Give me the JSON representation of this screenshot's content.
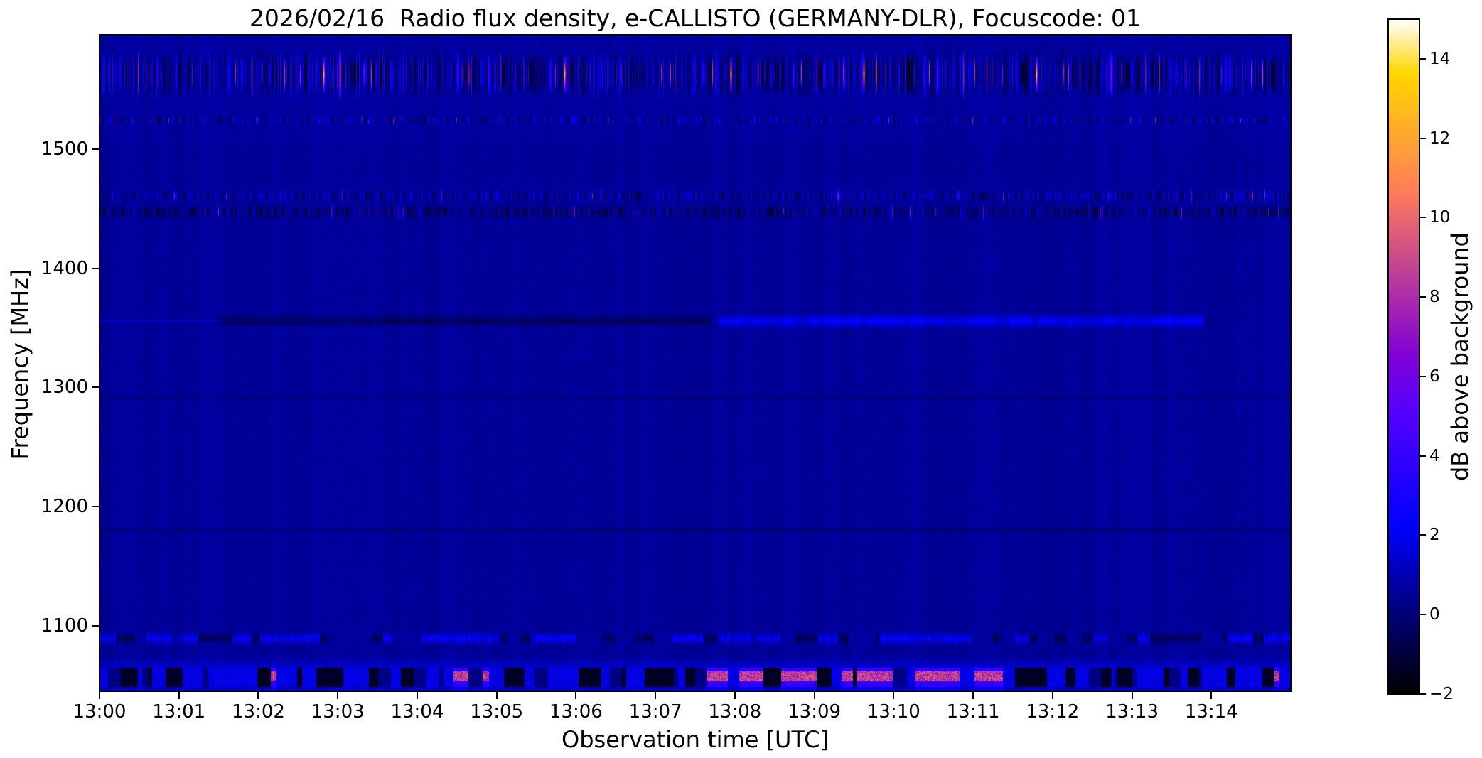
{
  "figure": {
    "title": "2026/02/16  Radio flux density, e-CALLISTO (GERMANY-DLR), Focuscode: 01"
  },
  "axes": {
    "xlabel": "Observation time [UTC]",
    "ylabel": "Frequency [MHz]",
    "x_ticks": [
      "13:00",
      "13:01",
      "13:02",
      "13:03",
      "13:04",
      "13:05",
      "13:06",
      "13:07",
      "13:08",
      "13:09",
      "13:10",
      "13:11",
      "13:12",
      "13:13",
      "13:14"
    ],
    "y_ticks": [
      "1500",
      "1400",
      "1300",
      "1200",
      "1100"
    ]
  },
  "colorbar": {
    "label": "dB above background",
    "ticks": [
      "14",
      "12",
      "10",
      "8",
      "6",
      "4",
      "2",
      "0",
      "−2"
    ]
  },
  "chart_data": {
    "type": "heatmap",
    "subtype": "radio-spectrogram",
    "title": "2026/02/16  Radio flux density, e-CALLISTO (GERMANY-DLR), Focuscode: 01",
    "xlabel": "Observation time [UTC]",
    "ylabel": "Frequency [MHz]",
    "colorbar_label": "dB above background",
    "start_time_utc": "13:00",
    "x_range_minutes": [
      0,
      15
    ],
    "x_tick_labels": [
      "13:00",
      "13:01",
      "13:02",
      "13:03",
      "13:04",
      "13:05",
      "13:06",
      "13:07",
      "13:08",
      "13:09",
      "13:10",
      "13:11",
      "13:12",
      "13:13",
      "13:14"
    ],
    "freq_range_mhz": [
      1045,
      1596
    ],
    "freq_ticks_mhz": [
      1500,
      1400,
      1300,
      1200,
      1100
    ],
    "value_range_db": [
      -2,
      15
    ],
    "colorbar_tick_values": [
      14,
      12,
      10,
      8,
      6,
      4,
      2,
      0,
      -2
    ],
    "colormap": "gnuplot2",
    "grid": false,
    "background_level_db": 0.55,
    "features": [
      {
        "id": "band-1560",
        "kind": "heavy_speckle",
        "f_mhz": [
          1546,
          1580
        ],
        "t_min": [
          0,
          15
        ],
        "label": "strong vertically-striated RFI band, black/blue flicker with white-yellow spikes",
        "hot_spikes_t": [
          2.82,
          5.85,
          7.95,
          9.62,
          11.8
        ]
      },
      {
        "id": "line-1524",
        "kind": "speckle",
        "f_mhz": [
          1521,
          1528
        ],
        "t_min": [
          0,
          15
        ],
        "label": "thin speckled RFI line"
      },
      {
        "id": "band-1462",
        "kind": "speckle",
        "f_mhz": [
          1456,
          1466
        ],
        "t_min": [
          0,
          15
        ],
        "label": "speckled RFI band"
      },
      {
        "id": "band-1448",
        "kind": "speckle_dark",
        "f_mhz": [
          1442,
          1453
        ],
        "t_min": [
          0,
          15
        ],
        "label": "dark speckled RFI band"
      },
      {
        "id": "line-1357-bright-left",
        "kind": "bright_line",
        "f_mhz": [
          1355,
          1358
        ],
        "t_min": [
          0,
          3.5
        ],
        "level_db": 1.7,
        "label": "thin bright blue carrier line"
      },
      {
        "id": "lane-1357-dark",
        "kind": "dark_lane",
        "f_mhz": [
          1352,
          1360
        ],
        "t_min": [
          1.5,
          7.7
        ],
        "depth_db": 1.05,
        "label": "dark absorption-like lane"
      },
      {
        "id": "band-1357-bright",
        "kind": "bright_band",
        "f_mhz": [
          1351,
          1361
        ],
        "t_min": [
          7.8,
          13.9
        ],
        "level_db": 1.55,
        "label": "diffuse bright blue emission band (radar)"
      },
      {
        "id": "line-1292-faint",
        "kind": "faint_dark",
        "f_mhz": [
          1290,
          1294
        ],
        "t_min": [
          0,
          15
        ],
        "depth_db": 0.35,
        "label": "very faint dark line"
      },
      {
        "id": "line-1180-faint",
        "kind": "faint_dark",
        "f_mhz": [
          1178,
          1183
        ],
        "t_min": [
          0,
          15
        ],
        "depth_db": 0.55,
        "label": "faint dark line"
      },
      {
        "id": "band-1087",
        "kind": "dash_speckle",
        "f_mhz": [
          1084,
          1095
        ],
        "t_min": [
          0,
          15
        ],
        "label": "dashed blue/dark RFI band"
      },
      {
        "id": "band-1060",
        "kind": "heavy_speckle_bottom",
        "f_mhz": [
          1045,
          1074
        ],
        "t_min": [
          0,
          15
        ],
        "label": "strong bottom RFI band (DME region) with magenta bursts",
        "magenta_segments_t": [
          [
            7.55,
            9.0
          ],
          [
            9.15,
            9.95
          ],
          [
            10.2,
            11.35
          ],
          [
            14.7,
            15.0
          ]
        ],
        "magenta_blobs_t": [
          2.15,
          2.95,
          3.45,
          4.5,
          4.85,
          6.2
        ]
      }
    ]
  }
}
